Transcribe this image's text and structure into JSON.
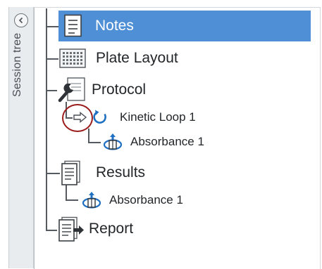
{
  "sidebar": {
    "label": "Session tree",
    "collapse_icon": "chevron-left-icon"
  },
  "tree": {
    "items": [
      {
        "label": "Notes",
        "icon": "notes-icon",
        "selected": true
      },
      {
        "label": "Plate Layout",
        "icon": "plate-grid-icon"
      },
      {
        "label": "Protocol",
        "icon": "wrench-icon"
      },
      {
        "label": "Kinetic Loop 1",
        "icon": "loop-icon"
      },
      {
        "label": "Absorbance 1",
        "icon": "absorbance-icon"
      },
      {
        "label": "Results",
        "icon": "results-icon"
      },
      {
        "label": "Absorbance 1",
        "icon": "absorbance-icon"
      },
      {
        "label": "Report",
        "icon": "report-icon"
      }
    ]
  },
  "colors": {
    "selection": "#4e8fd6",
    "highlight_circle": "#9b1c1c"
  }
}
